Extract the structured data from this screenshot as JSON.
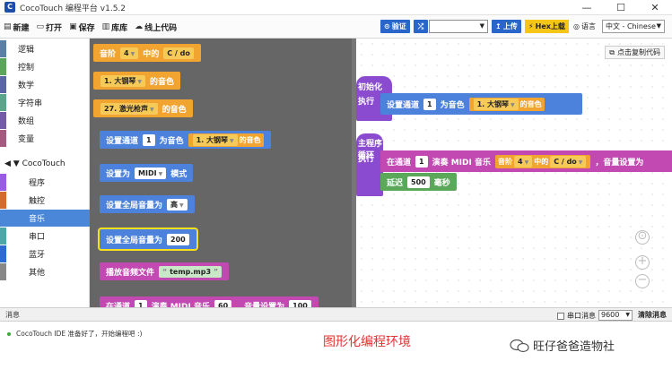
{
  "window": {
    "title": "CocoTouch 编程平台 v1.5.2",
    "logo_letter": "C",
    "minimize": "—",
    "maximize": "☐",
    "close": "✕"
  },
  "toolbar": {
    "new": "新建",
    "open": "打开",
    "save": "保存",
    "library": "库库",
    "online": "线上代码",
    "verify": "验证",
    "upload": "上传",
    "hex_upload": "Hex上载",
    "language_label": "语言",
    "language_value": "中文 - Chinese"
  },
  "categories": [
    {
      "label": "逻辑",
      "color": "#5b80a5"
    },
    {
      "label": "控制",
      "color": "#5ba55b"
    },
    {
      "label": "数学",
      "color": "#5b67a5"
    },
    {
      "label": "字符串",
      "color": "#5ba58c"
    },
    {
      "label": "数组",
      "color": "#745ba5"
    },
    {
      "label": "变量",
      "color": "#a55b80"
    }
  ],
  "group": {
    "label": "◀ ▼ CocoTouch"
  },
  "subcategories": [
    {
      "label": "程序",
      "color": "#9a5ce6"
    },
    {
      "label": "触控",
      "color": "#d56a2b"
    },
    {
      "label": "音乐",
      "color": "#4a87d8",
      "selected": true
    },
    {
      "label": "串口",
      "color": "#4aa8a8"
    },
    {
      "label": "蓝牙",
      "color": "#2b6bd5"
    },
    {
      "label": "其他",
      "color": "#888888"
    }
  ],
  "flyout": {
    "b1": {
      "pre": "音阶",
      "n": "4",
      "mid": "中的",
      "note": "C / do"
    },
    "b2": {
      "text": "1. 大钢琴",
      "suffix": "的音色"
    },
    "b3": {
      "text": "27. 激光枪声",
      "suffix": "的音色"
    },
    "b4": {
      "pre": "设置通道",
      "n": "1",
      "mid": "为音色",
      "inst": "1. 大钢琴",
      "suffix": "的音色"
    },
    "b5": {
      "pre": "设置为",
      "mode": "MIDI",
      "suffix": "模式"
    },
    "b6": {
      "pre": "设置全局音量为",
      "val": "高"
    },
    "b7": {
      "pre": "设置全局音量为",
      "val": "200"
    },
    "b8": {
      "pre": "播放音频文件",
      "file": "temp.mp3"
    },
    "b9": {
      "pre": "在通道",
      "ch": "1",
      "mid": "演奏 MIDI 音乐",
      "note": "60",
      "vol_label": "，音量设置为",
      "vol": "100"
    }
  },
  "workspace": {
    "copy_code": "点击复制代码",
    "setup_hat": {
      "line1": "初始化",
      "line2": "执行"
    },
    "setup_block": {
      "pre": "设置通道",
      "n": "1",
      "mid": "为音色",
      "inst": "1. 大钢琴",
      "suffix": "的音色"
    },
    "loop_hat": {
      "line1": "主程序循环",
      "line2": "执行"
    },
    "play_block": {
      "pre": "在通道",
      "ch": "1",
      "mid": "演奏 MIDI 音乐",
      "scale_pre": "音阶",
      "scale": "4",
      "scale_mid": "中的",
      "note": "C / do",
      "vol_label": "，音量设置为"
    },
    "delay_block": {
      "pre": "延迟",
      "ms": "500",
      "unit": "毫秒"
    },
    "zoom_reset": "⊙",
    "zoom_in": "+",
    "zoom_out": "−"
  },
  "messages": {
    "title": "消息",
    "serial_label": "串口消息",
    "baud": "9600",
    "clear": "清除消息",
    "log": "CocoTouch IDE 准备好了，开始编程吧 :)"
  },
  "caption": "图形化编程环境",
  "watermark": "旺仔爸爸造物社",
  "colors": {
    "orange_block": "#f2a431",
    "blue_block": "#4c82dc",
    "pink_block": "#c248b2",
    "purple_hat": "#8a4bd1",
    "green_block": "#5ba85b",
    "caption_red": "#e23232"
  }
}
